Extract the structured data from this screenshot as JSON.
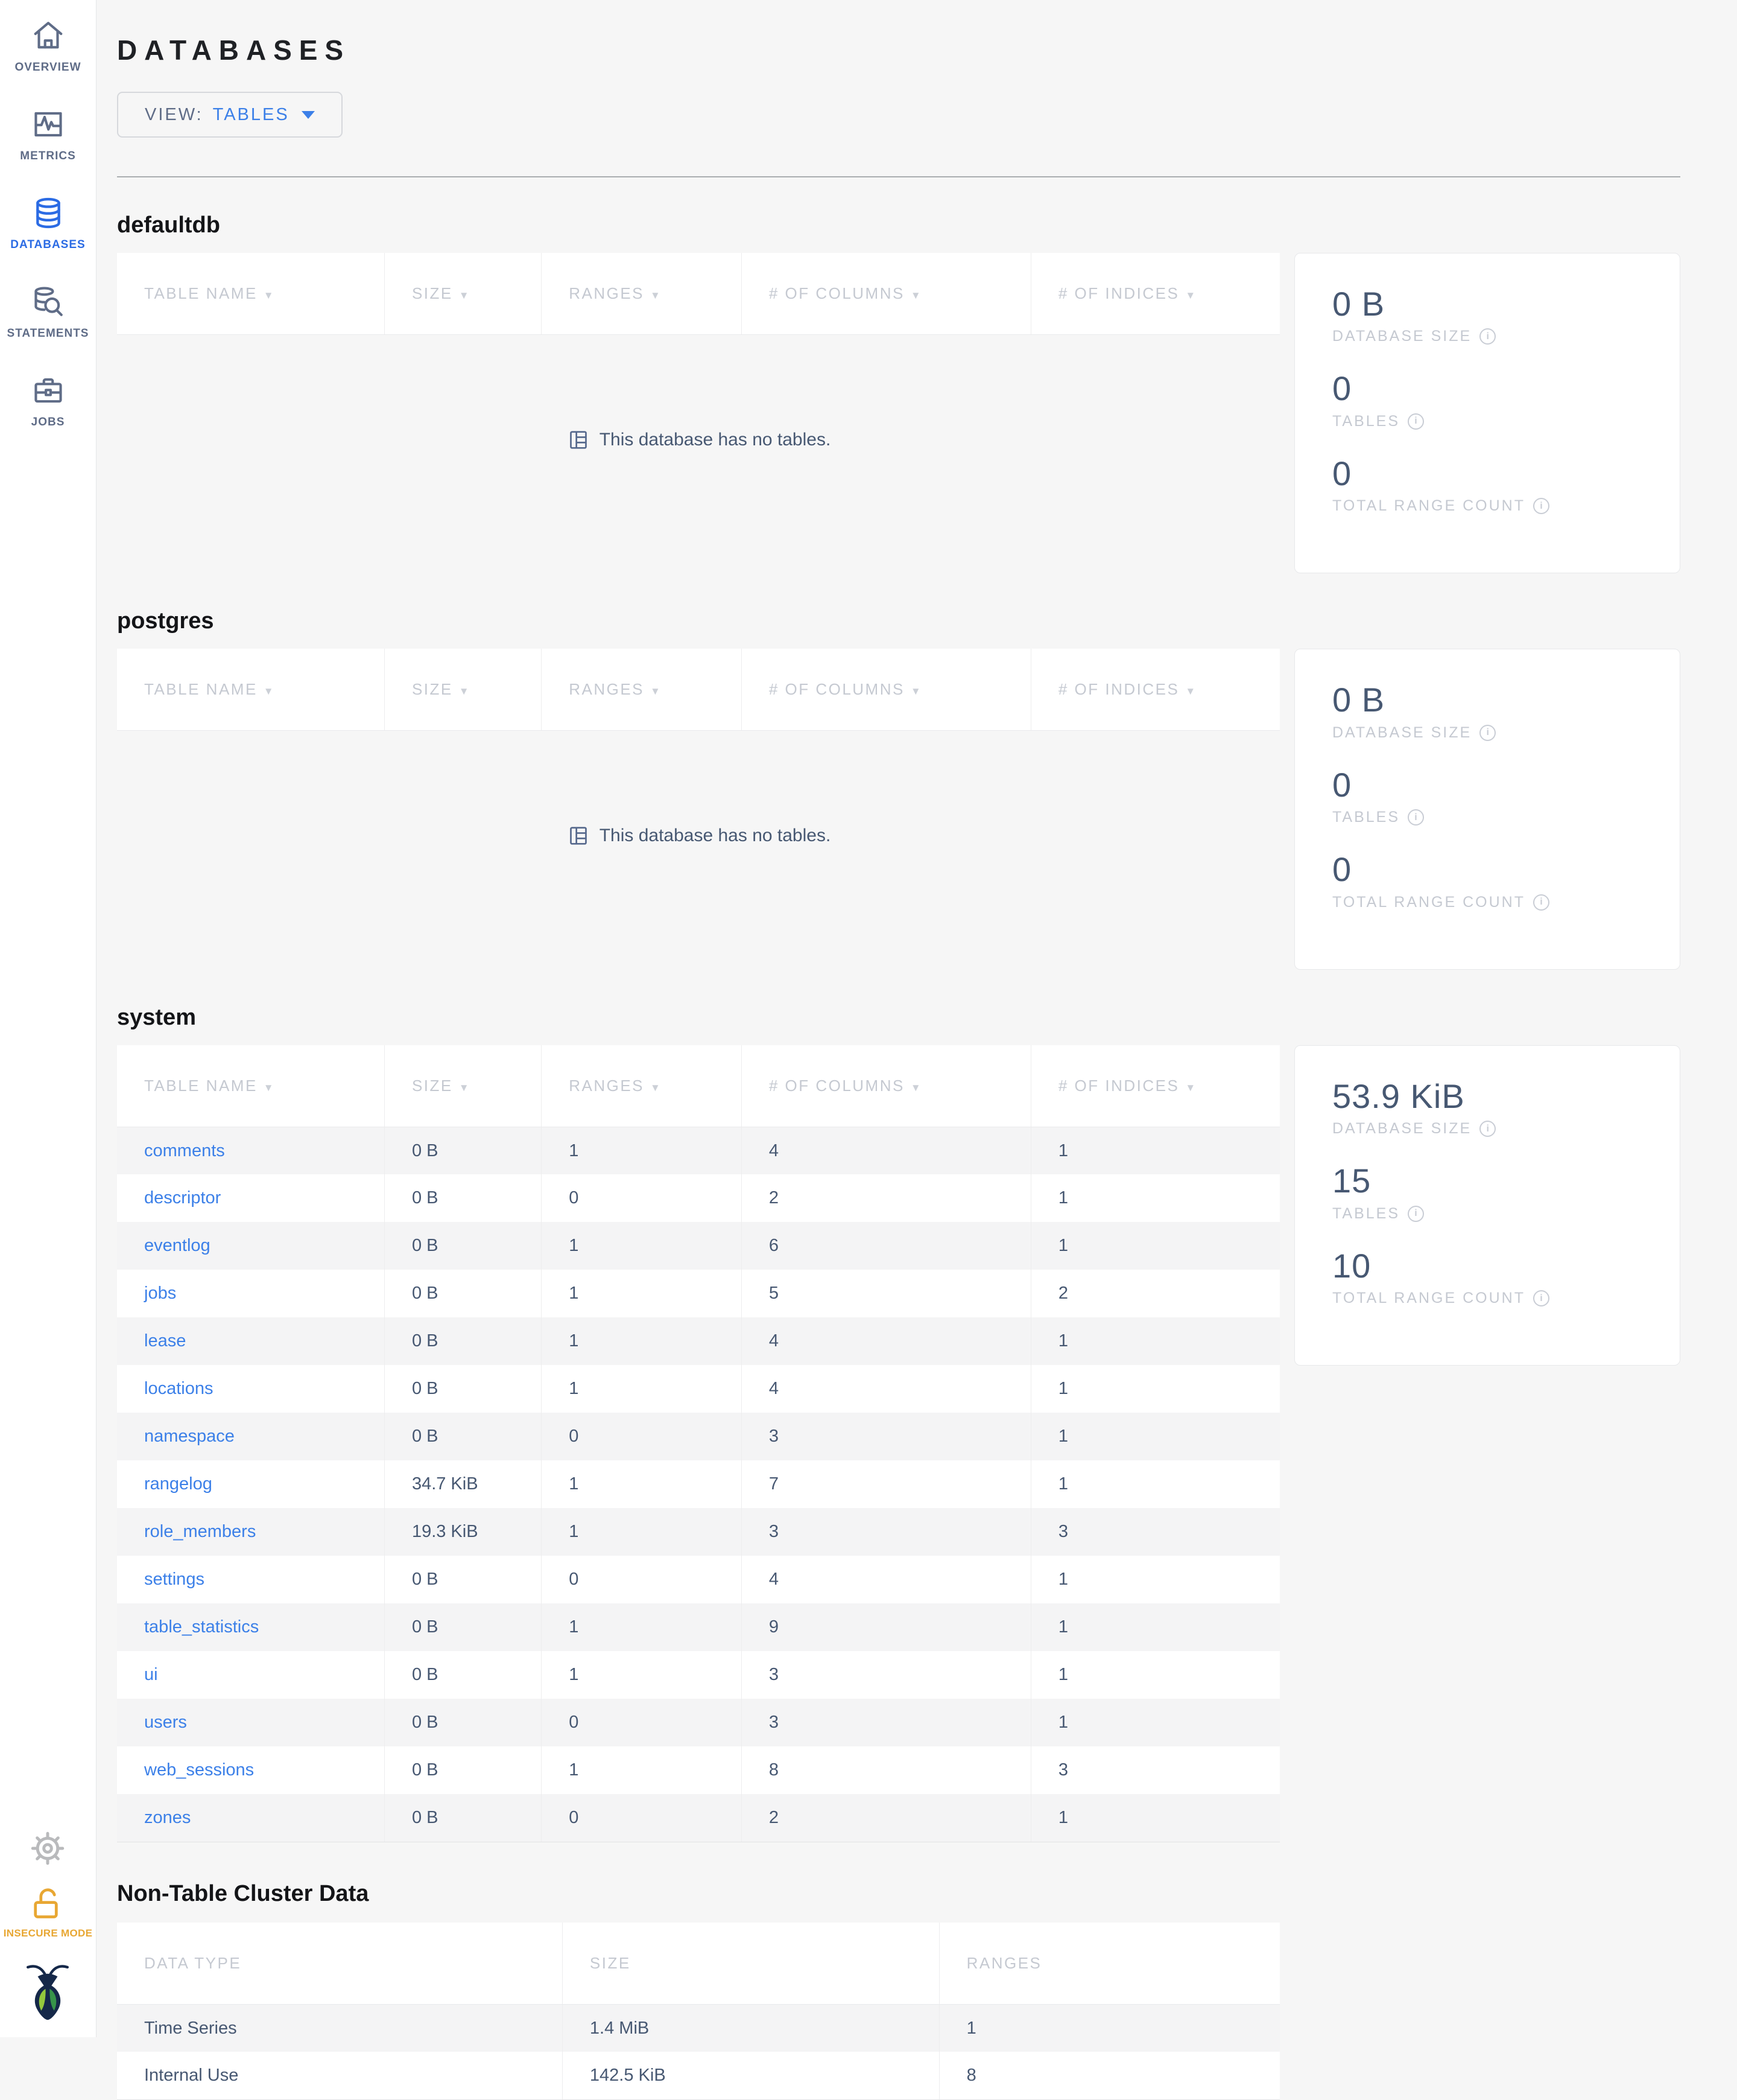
{
  "header": {
    "title": "DATABASES"
  },
  "toolbar": {
    "view_label": "VIEW:",
    "view_value": "TABLES"
  },
  "icons": {
    "sort_caret": "▼",
    "info": "i"
  },
  "colors": {
    "accent_blue": "#2b6be4",
    "link_blue": "#3c80e8",
    "insecure_yellow": "#e8a733",
    "logo_navy": "#152849",
    "leaf_green_light": "#94c83d",
    "leaf_green_dark": "#37944a"
  },
  "sidebar": {
    "items": [
      {
        "id": "overview",
        "label": "OVERVIEW",
        "icon": "home-icon",
        "active": false
      },
      {
        "id": "metrics",
        "label": "METRICS",
        "icon": "metrics-graph-icon",
        "active": false
      },
      {
        "id": "databases",
        "label": "DATABASES",
        "icon": "database-icon",
        "active": true
      },
      {
        "id": "statements",
        "label": "STATEMENTS",
        "icon": "database-search-icon",
        "active": false
      },
      {
        "id": "jobs",
        "label": "JOBS",
        "icon": "briefcase-icon",
        "active": false
      }
    ],
    "insecure_label": "INSECURE MODE"
  },
  "databases": [
    {
      "name": "defaultdb",
      "columns": [
        "TABLE NAME",
        "SIZE",
        "RANGES",
        "# OF COLUMNS",
        "# OF INDICES"
      ],
      "rows": [],
      "empty_message": "This database has no tables.",
      "stats": {
        "size": "0 B",
        "size_label": "DATABASE SIZE",
        "tables": "0",
        "tables_label": "TABLES",
        "ranges": "0",
        "ranges_label": "TOTAL RANGE COUNT"
      }
    },
    {
      "name": "postgres",
      "columns": [
        "TABLE NAME",
        "SIZE",
        "RANGES",
        "# OF COLUMNS",
        "# OF INDICES"
      ],
      "rows": [],
      "empty_message": "This database has no tables.",
      "stats": {
        "size": "0 B",
        "size_label": "DATABASE SIZE",
        "tables": "0",
        "tables_label": "TABLES",
        "ranges": "0",
        "ranges_label": "TOTAL RANGE COUNT"
      }
    },
    {
      "name": "system",
      "columns": [
        "TABLE NAME",
        "SIZE",
        "RANGES",
        "# OF COLUMNS",
        "# OF INDICES"
      ],
      "rows": [
        {
          "name": "comments",
          "size": "0 B",
          "ranges": "1",
          "columns": "4",
          "indices": "1"
        },
        {
          "name": "descriptor",
          "size": "0 B",
          "ranges": "0",
          "columns": "2",
          "indices": "1"
        },
        {
          "name": "eventlog",
          "size": "0 B",
          "ranges": "1",
          "columns": "6",
          "indices": "1"
        },
        {
          "name": "jobs",
          "size": "0 B",
          "ranges": "1",
          "columns": "5",
          "indices": "2"
        },
        {
          "name": "lease",
          "size": "0 B",
          "ranges": "1",
          "columns": "4",
          "indices": "1"
        },
        {
          "name": "locations",
          "size": "0 B",
          "ranges": "1",
          "columns": "4",
          "indices": "1"
        },
        {
          "name": "namespace",
          "size": "0 B",
          "ranges": "0",
          "columns": "3",
          "indices": "1"
        },
        {
          "name": "rangelog",
          "size": "34.7 KiB",
          "ranges": "1",
          "columns": "7",
          "indices": "1"
        },
        {
          "name": "role_members",
          "size": "19.3 KiB",
          "ranges": "1",
          "columns": "3",
          "indices": "3"
        },
        {
          "name": "settings",
          "size": "0 B",
          "ranges": "0",
          "columns": "4",
          "indices": "1"
        },
        {
          "name": "table_statistics",
          "size": "0 B",
          "ranges": "1",
          "columns": "9",
          "indices": "1"
        },
        {
          "name": "ui",
          "size": "0 B",
          "ranges": "1",
          "columns": "3",
          "indices": "1"
        },
        {
          "name": "users",
          "size": "0 B",
          "ranges": "0",
          "columns": "3",
          "indices": "1"
        },
        {
          "name": "web_sessions",
          "size": "0 B",
          "ranges": "1",
          "columns": "8",
          "indices": "3"
        },
        {
          "name": "zones",
          "size": "0 B",
          "ranges": "0",
          "columns": "2",
          "indices": "1"
        }
      ],
      "empty_message": "",
      "stats": {
        "size": "53.9 KiB",
        "size_label": "DATABASE SIZE",
        "tables": "15",
        "tables_label": "TABLES",
        "ranges": "10",
        "ranges_label": "TOTAL RANGE COUNT"
      }
    }
  ],
  "non_table": {
    "title": "Non-Table Cluster Data",
    "columns": [
      "DATA TYPE",
      "SIZE",
      "RANGES"
    ],
    "rows": [
      {
        "type": "Time Series",
        "size": "1.4 MiB",
        "ranges": "1"
      },
      {
        "type": "Internal Use",
        "size": "142.5 KiB",
        "ranges": "8"
      }
    ]
  }
}
